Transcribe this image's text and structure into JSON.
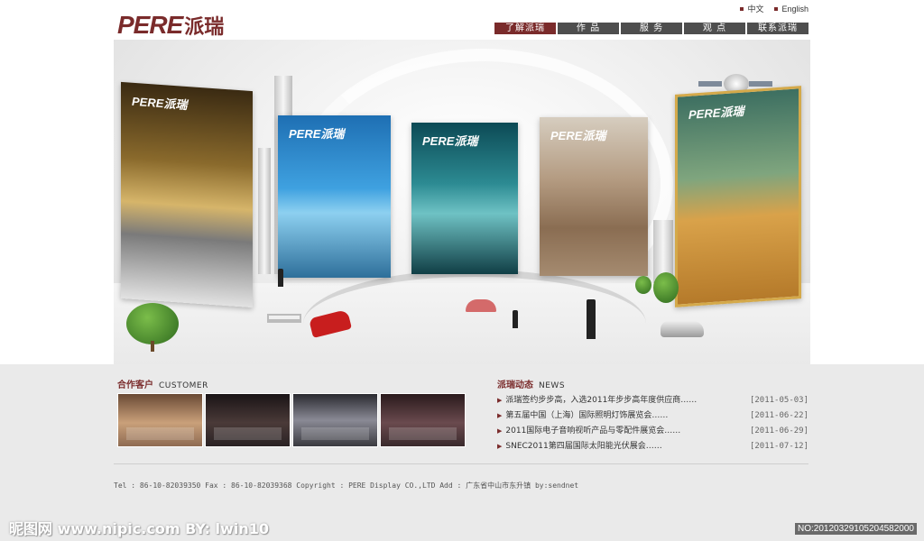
{
  "brand": {
    "latin": "PERE",
    "cjk": "派瑞"
  },
  "lang": {
    "chinese": "中文",
    "english": "English"
  },
  "nav": [
    {
      "label": "了解派瑞",
      "active": true
    },
    {
      "label": "作 品",
      "active": false
    },
    {
      "label": "服 务",
      "active": false
    },
    {
      "label": "观 点",
      "active": false
    },
    {
      "label": "联系派瑞",
      "active": false
    }
  ],
  "banner": {
    "panel_brand": "PERE派瑞"
  },
  "customer": {
    "title_cn": "合作客户",
    "title_en": "CUSTOMER"
  },
  "news": {
    "title_cn": "派瑞动态",
    "title_en": "NEWS",
    "items": [
      {
        "text": "派瑞签约步步高，入选2011年步步高年度供应商……",
        "date": "[2011-05-03]"
      },
      {
        "text": "第五届中国（上海）国际照明灯饰展览会……",
        "date": "[2011-06-22]"
      },
      {
        "text": "2011国际电子音响视听产品与零配件展览会……",
        "date": "[2011-06-29]"
      },
      {
        "text": "SNEC2011第四届国际太阳能光伏展会……",
        "date": "[2011-07-12]"
      }
    ]
  },
  "footer": {
    "text": "Tel : 86-10-82039350  Fax : 86-10-82039368   Copyright : PERE Display CO.,LTD   Add : 广东省中山市东升镇 by:sendnet"
  },
  "watermark": {
    "left": "昵图网 www.nipic.com  BY: lwin10",
    "right": "NO:20120329105204582000"
  },
  "colors": {
    "accent": "#7a2b2b",
    "nav": "#4e4e4e",
    "lower_bg": "#eaeaea"
  }
}
